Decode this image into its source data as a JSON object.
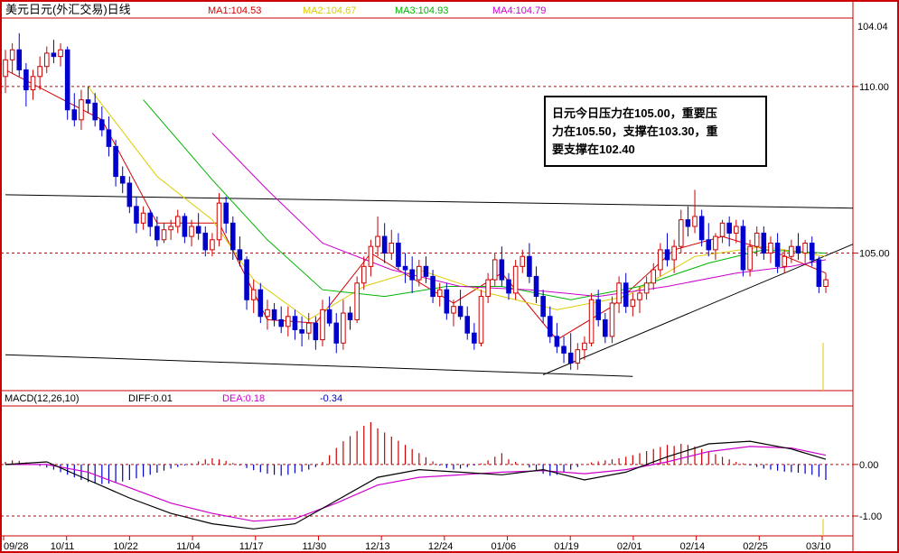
{
  "header": {
    "title": "美元日元(外汇交易)日线",
    "ma": [
      {
        "label": "MA1:104.53",
        "color": "#d40000"
      },
      {
        "label": "MA2:104.67",
        "color": "#ddcc00"
      },
      {
        "label": "MA3:104.93",
        "color": "#00b400"
      },
      {
        "label": "MA4:104.79",
        "color": "#cc00cc"
      }
    ]
  },
  "annotation": {
    "lines": [
      "日元今日压力在105.00，重要压",
      "力在105.50，支撑在103.30，重",
      "要支撑在102.40"
    ]
  },
  "price_axis": {
    "top_label": "104.04",
    "levels": [
      {
        "label": "110.00",
        "value": 110.0
      },
      {
        "label": "105.00",
        "value": 105.0
      }
    ]
  },
  "macd_panel": {
    "title": "MACD(12,26,10)",
    "diff": "DIFF:0.01",
    "dea": "DEA:0.18",
    "macd": "-0.34",
    "levels": [
      {
        "label": "0.00",
        "value": 0.0
      },
      {
        "label": "-1.00",
        "value": -1.0
      }
    ]
  },
  "dates": [
    "09/28",
    "10/11",
    "10/22",
    "11/04",
    "11/17",
    "11/30",
    "12/13",
    "12/24",
    "01/06",
    "01/19",
    "02/01",
    "02/14",
    "02/25",
    "03/10"
  ],
  "colors": {
    "frame": "#cc0000",
    "up": "#cc0000",
    "down": "#0000cc",
    "ma1": "#d40000",
    "ma2": "#ddcc00",
    "ma3": "#00b400",
    "ma4": "#cc00cc",
    "diff_line": "#000000",
    "dea_line": "#cc00cc"
  },
  "chart_data": {
    "type": "candlestick",
    "price_ylim": [
      100.9,
      112.0
    ],
    "macd_ylim": [
      -1.35,
      1.1
    ],
    "candles": [
      [
        110.3,
        111.1,
        109.8,
        110.8
      ],
      [
        110.8,
        111.3,
        110.4,
        111.1
      ],
      [
        111.1,
        111.6,
        110.3,
        110.5
      ],
      [
        110.5,
        110.7,
        109.4,
        109.9
      ],
      [
        109.9,
        110.5,
        109.6,
        110.3
      ],
      [
        110.3,
        110.9,
        109.9,
        110.6
      ],
      [
        110.6,
        111.2,
        110.4,
        111.0
      ],
      [
        111.0,
        111.4,
        110.7,
        110.9
      ],
      [
        110.9,
        111.3,
        110.6,
        111.1
      ],
      [
        111.1,
        111.2,
        109.0,
        109.3
      ],
      [
        109.3,
        109.8,
        108.8,
        109.0
      ],
      [
        109.0,
        109.9,
        108.7,
        109.6
      ],
      [
        109.6,
        110.0,
        109.2,
        109.5
      ],
      [
        109.5,
        109.8,
        108.8,
        109.0
      ],
      [
        109.0,
        109.4,
        108.5,
        108.7
      ],
      [
        108.7,
        109.1,
        107.9,
        108.2
      ],
      [
        108.2,
        108.4,
        107.0,
        107.3
      ],
      [
        107.3,
        107.6,
        106.8,
        107.1
      ],
      [
        107.1,
        107.3,
        106.2,
        106.4
      ],
      [
        106.4,
        106.7,
        105.6,
        105.9
      ],
      [
        105.9,
        106.4,
        105.7,
        106.2
      ],
      [
        106.2,
        106.3,
        105.5,
        105.8
      ],
      [
        105.8,
        106.1,
        105.2,
        105.4
      ],
      [
        105.4,
        105.9,
        105.3,
        105.7
      ],
      [
        105.7,
        106.0,
        105.4,
        105.8
      ],
      [
        105.8,
        106.3,
        105.6,
        106.1
      ],
      [
        106.1,
        106.2,
        105.3,
        105.5
      ],
      [
        105.5,
        106.0,
        105.2,
        105.8
      ],
      [
        105.8,
        106.2,
        105.4,
        105.6
      ],
      [
        105.6,
        105.8,
        104.9,
        105.1
      ],
      [
        105.1,
        105.6,
        104.9,
        105.4
      ],
      [
        105.4,
        106.8,
        105.2,
        106.5
      ],
      [
        106.5,
        106.7,
        105.6,
        105.9
      ],
      [
        105.9,
        106.1,
        104.8,
        105.1
      ],
      [
        105.1,
        105.5,
        104.6,
        104.8
      ],
      [
        104.8,
        104.9,
        103.3,
        103.6
      ],
      [
        103.6,
        104.2,
        103.2,
        103.9
      ],
      [
        103.9,
        104.1,
        102.9,
        103.1
      ],
      [
        103.1,
        103.6,
        102.7,
        103.3
      ],
      [
        103.3,
        103.5,
        102.8,
        103.0
      ],
      [
        103.0,
        103.4,
        102.6,
        102.8
      ],
      [
        102.8,
        103.4,
        102.5,
        103.1
      ],
      [
        103.1,
        103.3,
        102.4,
        102.7
      ],
      [
        102.7,
        103.1,
        102.2,
        102.6
      ],
      [
        102.6,
        103.2,
        102.4,
        102.9
      ],
      [
        102.9,
        103.1,
        102.1,
        102.4
      ],
      [
        102.4,
        103.6,
        102.2,
        103.3
      ],
      [
        103.3,
        103.7,
        102.8,
        102.9
      ],
      [
        102.9,
        103.2,
        102.0,
        102.3
      ],
      [
        102.3,
        103.6,
        102.1,
        103.2
      ],
      [
        103.2,
        103.4,
        102.7,
        103.0
      ],
      [
        103.0,
        104.3,
        102.9,
        104.1
      ],
      [
        104.1,
        104.9,
        103.9,
        104.6
      ],
      [
        104.6,
        105.4,
        104.3,
        105.2
      ],
      [
        105.2,
        106.1,
        104.9,
        105.5
      ],
      [
        105.5,
        105.9,
        104.7,
        105.0
      ],
      [
        105.0,
        105.7,
        104.8,
        105.3
      ],
      [
        105.3,
        105.6,
        104.5,
        104.6
      ],
      [
        104.6,
        105.0,
        104.1,
        104.5
      ],
      [
        104.5,
        104.9,
        103.8,
        104.2
      ],
      [
        104.2,
        104.8,
        104.0,
        104.6
      ],
      [
        104.6,
        104.9,
        104.1,
        104.3
      ],
      [
        104.3,
        104.5,
        103.5,
        103.7
      ],
      [
        103.7,
        104.1,
        103.4,
        103.9
      ],
      [
        103.9,
        104.1,
        103.0,
        103.2
      ],
      [
        103.2,
        103.6,
        102.8,
        103.4
      ],
      [
        103.4,
        103.9,
        103.0,
        103.1
      ],
      [
        103.1,
        103.4,
        102.4,
        102.6
      ],
      [
        102.6,
        102.9,
        102.1,
        102.3
      ],
      [
        102.3,
        103.9,
        102.2,
        103.7
      ],
      [
        103.7,
        104.4,
        103.5,
        104.2
      ],
      [
        104.2,
        105.0,
        104.0,
        104.8
      ],
      [
        104.8,
        105.2,
        104.0,
        104.2
      ],
      [
        104.2,
        104.4,
        103.6,
        103.8
      ],
      [
        103.8,
        104.8,
        103.6,
        104.6
      ],
      [
        104.6,
        105.1,
        104.4,
        104.9
      ],
      [
        104.9,
        105.3,
        104.1,
        104.3
      ],
      [
        104.3,
        104.6,
        103.5,
        103.7
      ],
      [
        103.7,
        103.9,
        102.9,
        103.1
      ],
      [
        103.1,
        103.4,
        102.3,
        102.5
      ],
      [
        102.5,
        102.9,
        102.0,
        102.2
      ],
      [
        102.2,
        102.5,
        101.7,
        102.0
      ],
      [
        102.0,
        102.6,
        101.5,
        101.7
      ],
      [
        101.7,
        102.3,
        101.5,
        102.1
      ],
      [
        102.1,
        102.5,
        101.8,
        102.3
      ],
      [
        102.3,
        103.8,
        102.2,
        103.6
      ],
      [
        103.6,
        103.9,
        102.8,
        103.0
      ],
      [
        103.0,
        103.2,
        102.3,
        102.5
      ],
      [
        102.5,
        103.7,
        102.3,
        103.5
      ],
      [
        103.5,
        104.3,
        103.2,
        104.1
      ],
      [
        104.1,
        104.4,
        103.2,
        103.4
      ],
      [
        103.4,
        103.8,
        103.1,
        103.6
      ],
      [
        103.6,
        104.0,
        103.2,
        103.8
      ],
      [
        103.8,
        104.3,
        103.6,
        104.1
      ],
      [
        104.1,
        104.7,
        103.9,
        104.5
      ],
      [
        104.5,
        105.3,
        104.3,
        105.1
      ],
      [
        105.1,
        105.6,
        104.6,
        104.8
      ],
      [
        104.8,
        105.4,
        104.4,
        105.2
      ],
      [
        105.2,
        106.3,
        105.0,
        106.0
      ],
      [
        106.0,
        106.4,
        105.5,
        105.8
      ],
      [
        105.8,
        106.9,
        105.6,
        106.1
      ],
      [
        106.1,
        106.3,
        105.2,
        105.4
      ],
      [
        105.4,
        105.9,
        104.9,
        105.1
      ],
      [
        105.1,
        105.6,
        104.8,
        105.5
      ],
      [
        105.5,
        106.0,
        105.3,
        105.9
      ],
      [
        105.9,
        106.1,
        105.2,
        105.6
      ],
      [
        105.6,
        106.0,
        105.3,
        105.8
      ],
      [
        105.8,
        106.0,
        104.3,
        104.5
      ],
      [
        104.5,
        105.4,
        104.3,
        105.2
      ],
      [
        105.2,
        105.8,
        104.9,
        105.6
      ],
      [
        105.6,
        105.8,
        104.8,
        105.0
      ],
      [
        105.0,
        105.5,
        104.7,
        105.3
      ],
      [
        105.3,
        105.6,
        104.4,
        104.6
      ],
      [
        104.6,
        105.1,
        104.4,
        104.9
      ],
      [
        104.9,
        105.4,
        104.7,
        105.2
      ],
      [
        105.2,
        105.6,
        104.8,
        105.0
      ],
      [
        105.0,
        105.4,
        104.7,
        105.3
      ],
      [
        105.3,
        105.5,
        104.6,
        104.8
      ],
      [
        104.8,
        104.9,
        103.8,
        104.0
      ],
      [
        104.0,
        104.4,
        103.8,
        104.2
      ]
    ],
    "ma1": [
      [
        0,
        110.5
      ],
      [
        14,
        109.0
      ],
      [
        22,
        105.9
      ],
      [
        31,
        105.9
      ],
      [
        38,
        103.0
      ],
      [
        45,
        102.9
      ],
      [
        53,
        105.0
      ],
      [
        65,
        103.5
      ],
      [
        72,
        104.4
      ],
      [
        80,
        102.4
      ],
      [
        88,
        103.4
      ],
      [
        97,
        105.1
      ],
      [
        104,
        105.5
      ],
      [
        112,
        105.0
      ],
      [
        119,
        104.4
      ]
    ],
    "ma2": [
      [
        12,
        110.0
      ],
      [
        22,
        107.3
      ],
      [
        30,
        106.0
      ],
      [
        36,
        104.2
      ],
      [
        44,
        103.0
      ],
      [
        52,
        104.0
      ],
      [
        60,
        104.5
      ],
      [
        70,
        103.8
      ],
      [
        80,
        103.3
      ],
      [
        90,
        103.7
      ],
      [
        100,
        104.9
      ],
      [
        110,
        105.2
      ],
      [
        119,
        104.9
      ]
    ],
    "ma3": [
      [
        20,
        109.6
      ],
      [
        30,
        107.2
      ],
      [
        38,
        105.4
      ],
      [
        46,
        103.9
      ],
      [
        55,
        103.7
      ],
      [
        64,
        104.0
      ],
      [
        72,
        104.0
      ],
      [
        82,
        103.6
      ],
      [
        92,
        104.0
      ],
      [
        102,
        104.7
      ],
      [
        110,
        105.1
      ],
      [
        119,
        105.0
      ]
    ],
    "ma4": [
      [
        30,
        108.6
      ],
      [
        38,
        106.9
      ],
      [
        46,
        105.3
      ],
      [
        56,
        104.5
      ],
      [
        66,
        104.0
      ],
      [
        76,
        103.9
      ],
      [
        86,
        103.7
      ],
      [
        96,
        104.0
      ],
      [
        106,
        104.4
      ],
      [
        114,
        104.6
      ],
      [
        119,
        104.8
      ]
    ],
    "trendlines": [
      {
        "from": [
          0,
          106.75
        ],
        "to": [
          119,
          106.35
        ]
      },
      {
        "from": [
          0,
          101.95
        ],
        "to": [
          91,
          101.3
        ]
      },
      {
        "from": [
          78,
          101.35
        ],
        "to": [
          119,
          105.05
        ]
      }
    ],
    "macd_hist": [
      0.05,
      0.08,
      0.07,
      0.04,
      0.0,
      -0.03,
      -0.06,
      -0.1,
      -0.15,
      -0.2,
      -0.25,
      -0.3,
      -0.34,
      -0.37,
      -0.38,
      -0.37,
      -0.35,
      -0.33,
      -0.3,
      -0.27,
      -0.24,
      -0.2,
      -0.16,
      -0.12,
      -0.08,
      -0.05,
      -0.02,
      0.02,
      0.06,
      0.1,
      0.12,
      0.1,
      0.07,
      0.03,
      -0.02,
      -0.07,
      -0.11,
      -0.15,
      -0.18,
      -0.2,
      -0.22,
      -0.2,
      -0.17,
      -0.14,
      -0.1,
      -0.05,
      0.05,
      0.18,
      0.32,
      0.45,
      0.55,
      0.65,
      0.75,
      0.82,
      0.7,
      0.62,
      0.54,
      0.46,
      0.38,
      0.3,
      0.22,
      0.14,
      0.06,
      -0.02,
      -0.07,
      -0.1,
      -0.08,
      -0.05,
      -0.02,
      0.02,
      0.08,
      0.15,
      0.22,
      0.1,
      0.05,
      0.0,
      -0.06,
      -0.12,
      -0.18,
      -0.22,
      -0.2,
      -0.16,
      -0.1,
      -0.05,
      0.0,
      0.04,
      0.06,
      0.08,
      0.1,
      0.12,
      0.15,
      0.18,
      0.22,
      0.26,
      0.3,
      0.34,
      0.38,
      0.36,
      0.4,
      0.38,
      0.35,
      0.3,
      0.25,
      0.2,
      0.15,
      0.1,
      0.05,
      0.02,
      -0.02,
      -0.05,
      -0.08,
      -0.1,
      -0.12,
      -0.14,
      -0.15,
      -0.16,
      -0.18,
      -0.2,
      -0.24,
      -0.3
    ],
    "diff": [
      [
        0,
        0.0
      ],
      [
        6,
        0.05
      ],
      [
        12,
        -0.3
      ],
      [
        18,
        -0.65
      ],
      [
        24,
        -0.95
      ],
      [
        30,
        -1.15
      ],
      [
        36,
        -1.25
      ],
      [
        42,
        -1.15
      ],
      [
        48,
        -0.7
      ],
      [
        54,
        -0.25
      ],
      [
        60,
        -0.1
      ],
      [
        66,
        -0.15
      ],
      [
        72,
        -0.2
      ],
      [
        78,
        -0.1
      ],
      [
        84,
        -0.3
      ],
      [
        90,
        -0.15
      ],
      [
        96,
        0.15
      ],
      [
        102,
        0.4
      ],
      [
        108,
        0.45
      ],
      [
        114,
        0.3
      ],
      [
        119,
        0.1
      ]
    ],
    "dea": [
      [
        0,
        0.0
      ],
      [
        6,
        0.0
      ],
      [
        12,
        -0.15
      ],
      [
        18,
        -0.45
      ],
      [
        24,
        -0.75
      ],
      [
        30,
        -0.95
      ],
      [
        36,
        -1.1
      ],
      [
        42,
        -1.05
      ],
      [
        48,
        -0.75
      ],
      [
        54,
        -0.4
      ],
      [
        60,
        -0.25
      ],
      [
        66,
        -0.2
      ],
      [
        72,
        -0.15
      ],
      [
        78,
        -0.12
      ],
      [
        84,
        -0.18
      ],
      [
        90,
        -0.1
      ],
      [
        96,
        0.05
      ],
      [
        102,
        0.25
      ],
      [
        108,
        0.35
      ],
      [
        114,
        0.32
      ],
      [
        119,
        0.18
      ]
    ]
  }
}
